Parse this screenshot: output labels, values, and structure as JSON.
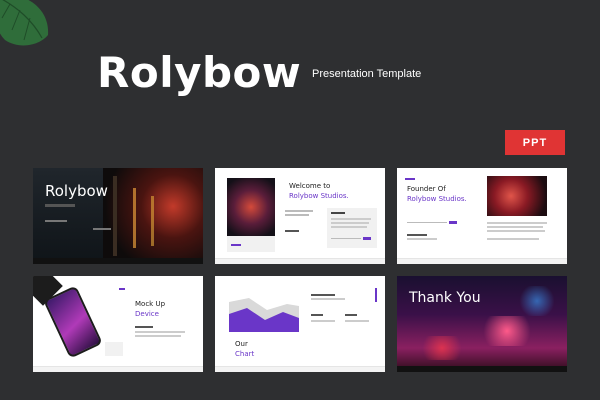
{
  "header": {
    "title": "Rolybow",
    "subtitle": "Presentation Template",
    "badge": "PPT"
  },
  "colors": {
    "background": "#2e2f31",
    "accent_purple": "#6a36c8",
    "badge_red": "#e03434"
  },
  "icons": {
    "leaf": "monstera-leaf-icon"
  },
  "slides": [
    {
      "title": "Rolybow"
    },
    {
      "title_line1": "Welcome to",
      "title_line2": "Rolybow Studios."
    },
    {
      "title_line1": "Founder Of",
      "title_line2": "Rolybow Studios."
    },
    {
      "title_line1": "Mock Up",
      "title_line2": "Device"
    },
    {
      "title_line1": "Our",
      "title_line2": "Chart"
    },
    {
      "title": "Thank You"
    }
  ]
}
